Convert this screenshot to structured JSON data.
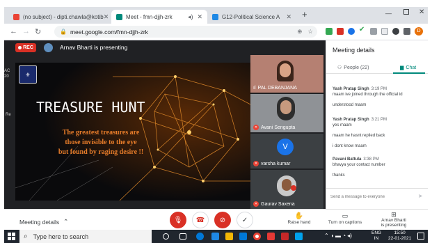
{
  "browser": {
    "tabs": [
      {
        "title": "(no subject) - dipti.chawla@kotib",
        "icon_color": "#ea4335",
        "active": false
      },
      {
        "title": "Meet - fmn-djjh-zrk",
        "icon_color": "#00897b",
        "active": true
      },
      {
        "title": "G12-Political Science A",
        "icon_color": "#1e88e5",
        "active": false
      }
    ],
    "url": "meet.google.com/fmn-djjh-zrk",
    "new_tab_label": "+"
  },
  "meet": {
    "rec_label": "REC",
    "presenting_text": "Arnav Bharti is presenting",
    "slide": {
      "title": "TREASURE  HUNT",
      "quote_line1": "The greatest treasures are",
      "quote_line2": "those invisible to the eye",
      "quote_line3": "but found by raging desire !!"
    },
    "participants": [
      {
        "name": "PAL DEBANJANA",
        "type": "video"
      },
      {
        "name": "Avani Sengupta",
        "type": "video"
      },
      {
        "name": "varsha kumar",
        "type": "avatar",
        "initial": "V"
      },
      {
        "name": "Gaurav Saxena",
        "type": "video"
      }
    ],
    "left_fragments": [
      "AC",
      "20",
      "Re"
    ]
  },
  "panel": {
    "title": "Meeting details",
    "people_label": "People (22)",
    "chat_label": "Chat",
    "messages": [
      {
        "sender": "Yash Pratap Singh",
        "time": "3:19 PM",
        "lines": [
          "maam ive joined through the official id",
          "understood maam"
        ]
      },
      {
        "sender": "Yash Pratap Singh",
        "time": "3:21 PM",
        "lines": [
          "yes maam",
          "maam he hasnt replied back",
          "i dont know maam"
        ]
      },
      {
        "sender": "Pavani Battula",
        "time": "3:38 PM",
        "lines": [
          "bhavya your contact number",
          "thanks"
        ]
      }
    ],
    "input_placeholder": "Send a message to everyone"
  },
  "bottom": {
    "meeting_details": "Meeting details",
    "raise_hand": "Raise hand",
    "captions": "Turn on captions",
    "presenting_line1": "Arnav Bharti",
    "presenting_line2": "is presenting"
  },
  "taskbar": {
    "search_placeholder": "Type here to search",
    "lang": "ENG",
    "region": "IN",
    "time": "15:50",
    "date": "22-01-2021"
  },
  "colors": {
    "accent": "#1a73e8",
    "chat_green": "#00897b",
    "red": "#ea4335"
  }
}
